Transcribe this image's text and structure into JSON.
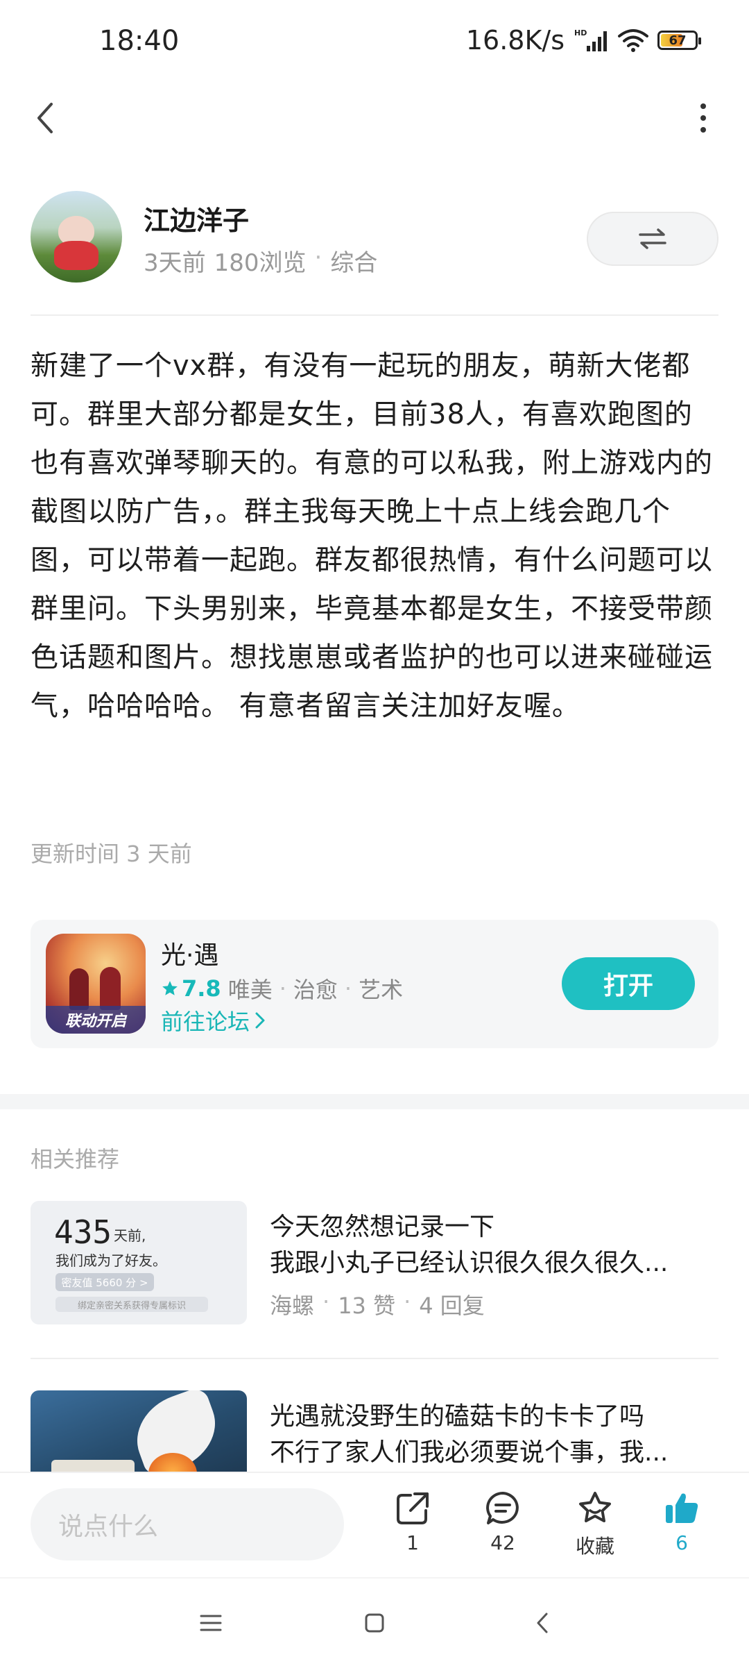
{
  "status_bar": {
    "time": "18:40",
    "network_speed": "16.8K/s",
    "battery": "67",
    "icons": [
      "hd-signal-icon",
      "wifi-icon",
      "battery-icon"
    ]
  },
  "nav": {
    "back_icon": "chevron-left-icon",
    "more_icon": "more-vertical-icon"
  },
  "author": {
    "name": "江边洋子",
    "time": "3天前",
    "views": "180浏览",
    "separator": "·",
    "category": "综合",
    "switch_icon": "swap-arrows-icon"
  },
  "post": {
    "body": "新建了一个vx群，有没有一起玩的朋友，萌新大佬都可。群里大部分都是女生，目前38人，有喜欢跑图的也有喜欢弹琴聊天的。有意的可以私我，附上游戏内的截图以防广告，。群主我每天晚上十点上线会跑几个图，可以带着一起跑。群友都很热情，有什么问题可以群里问。下头男别来，毕竟基本都是女生，不接受带颜色话题和图片。想找崽崽或者监护的也可以进来碰碰运气，哈哈哈哈。 有意者留言关注加好友喔。",
    "update_time": "更新时间 3 天前"
  },
  "game_card": {
    "icon_tag": "联动开启",
    "name": "光·遇",
    "rating": "7.8",
    "tags": [
      "唯美",
      "治愈",
      "艺术"
    ],
    "forum_link": "前往论坛",
    "open_button": "打开",
    "accent_color": "#1fc0c2"
  },
  "related": {
    "title": "相关推荐",
    "items": [
      {
        "line1": "今天忽然想记录一下",
        "line2": "我跟小丸子已经认识很久很久很久...",
        "author": "海螺",
        "likes": "13 赞",
        "replies": "4 回复",
        "thumb": {
          "big": "435",
          "small1": "天前,",
          "small2": "我们成为了好友。",
          "pill1": "密友值 5660 分 >",
          "pill2": "绑定亲密关系获得专属标识"
        }
      },
      {
        "line1": "光遇就没野生的磕菇卡的卡卡了吗",
        "line2": "不行了家人们我必须要说个事，我..."
      }
    ]
  },
  "action_bar": {
    "comment_placeholder": "说点什么",
    "share_count": "1",
    "comment_count": "42",
    "favorite_label": "收藏",
    "like_count": "6",
    "like_color": "#1fa9c9"
  },
  "system_nav": {
    "icons": [
      "menu-icon",
      "home-square-icon",
      "back-triangle-icon"
    ]
  }
}
